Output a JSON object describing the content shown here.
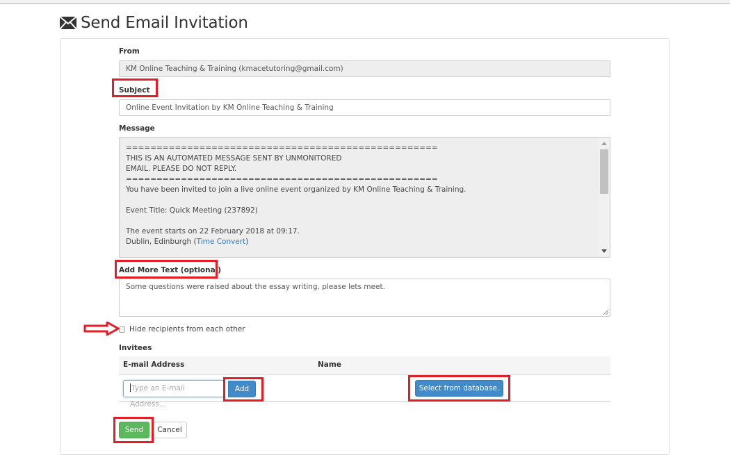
{
  "page": {
    "title": "Send Email Invitation",
    "title_icon": "envelope-icon"
  },
  "form": {
    "from_label": "From",
    "from_value": "KM Online Teaching & Training (kmacetutoring@gmail.com)",
    "subject_label": "Subject",
    "subject_value": "Online Event Invitation by KM Online Teaching & Training",
    "message_label": "Message",
    "message_lines": [
      "===================================================",
      "THIS IS AN AUTOMATED MESSAGE SENT BY UNMONITORED",
      "EMAIL. PLEASE DO NOT REPLY.",
      "===================================================",
      "You have been invited to join a live online event organized by KM Online Teaching & Training.",
      "",
      "Event Title: Quick Meeting (237892)",
      "",
      "The event starts on 22 February 2018 at 09:17."
    ],
    "message_location_prefix": "Dublin, Edinburgh (",
    "message_link": "Time Convert",
    "message_location_suffix": ")",
    "message_scroll_position": 0.0,
    "add_text_label": "Add More Text (optional)",
    "add_text_value": "Some questions were raised about the essay writing, please lets meet.",
    "hide_recipients_label": "Hide recipients from each other",
    "hide_recipients_checked": false
  },
  "invitees": {
    "label": "Invitees",
    "columns": [
      "E-mail Address",
      "Name"
    ],
    "email_placeholder": "Type an E-mail Address...",
    "add_button": "Add",
    "select_db_button": "Select from database."
  },
  "actions": {
    "send": "Send",
    "cancel": "Cancel"
  },
  "annotations": {
    "highlight_color": "#e41e26"
  }
}
